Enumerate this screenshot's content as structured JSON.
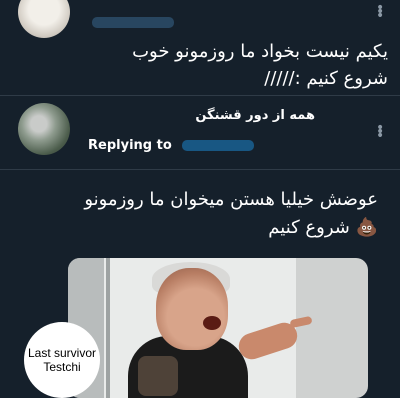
{
  "tweet1": {
    "name_cut": "...",
    "text_line1": "یکیم نیست بخواد ما روزمونو خوب",
    "text_line2": "شروع کنیم ://///"
  },
  "tweet2": {
    "display_name": "همه از دور قشنگن",
    "replying_label": "Replying to",
    "text_line1": "عوضش خیلیا هستن میخوان ما روزمونو",
    "text_line2": "💩 شروع کنیم"
  },
  "icons": {
    "more": "more-vertical-icon"
  },
  "watermark": {
    "line1": "Last survivor",
    "line2": "Testchi"
  },
  "colors": {
    "background": "#15202b",
    "text": "#ffffff",
    "muted": "#8b98a5",
    "link": "#1d9bf0"
  }
}
